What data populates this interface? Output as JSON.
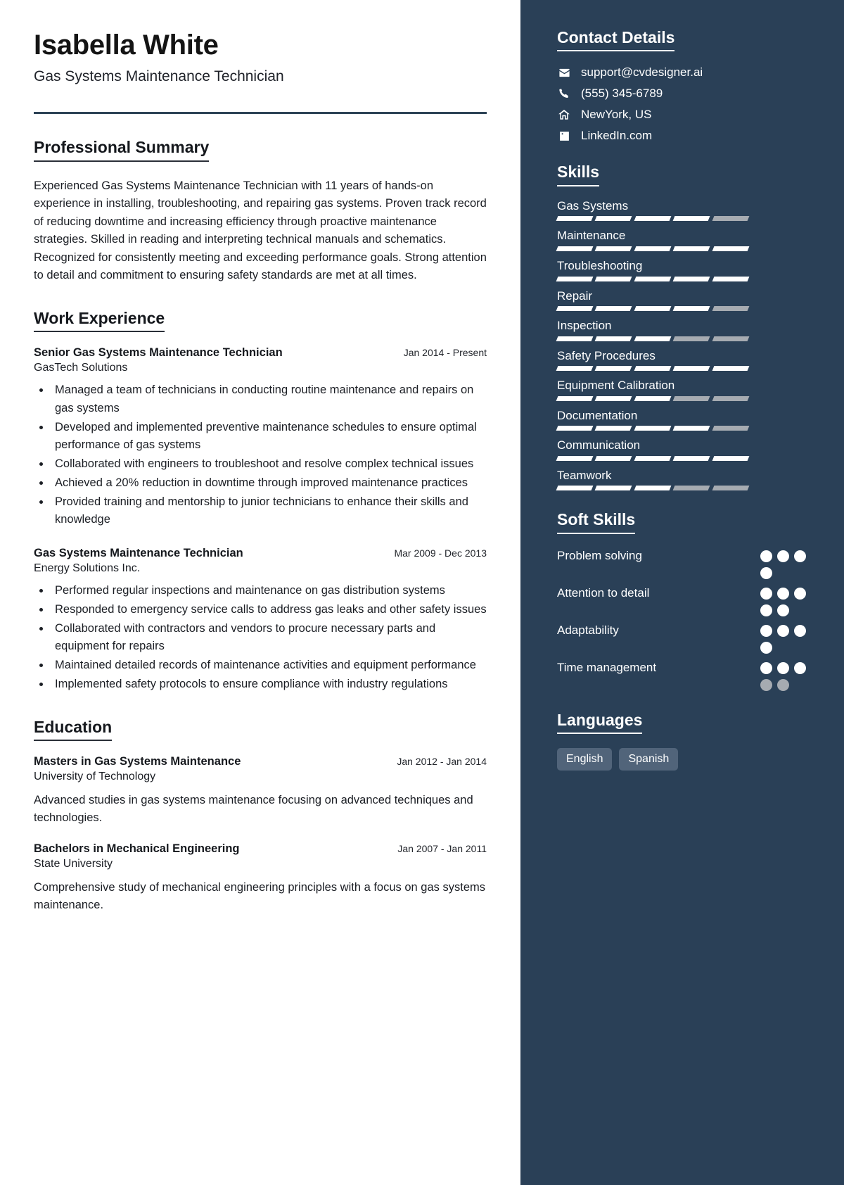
{
  "header": {
    "name": "Isabella White",
    "job_title": "Gas Systems Maintenance Technician"
  },
  "main": {
    "summary": {
      "heading": "Professional Summary",
      "text": "Experienced Gas Systems Maintenance Technician with 11 years of hands-on experience in installing, troubleshooting, and repairing gas systems. Proven track record of reducing downtime and increasing efficiency through proactive maintenance strategies. Skilled in reading and interpreting technical manuals and schematics. Recognized for consistently meeting and exceeding performance goals. Strong attention to detail and commitment to ensuring safety standards are met at all times."
    },
    "work": {
      "heading": "Work Experience",
      "entries": [
        {
          "title": "Senior Gas Systems Maintenance Technician",
          "date": "Jan 2014 - Present",
          "org": "GasTech Solutions",
          "bullets": [
            "Managed a team of technicians in conducting routine maintenance and repairs on gas systems",
            "Developed and implemented preventive maintenance schedules to ensure optimal performance of gas systems",
            "Collaborated with engineers to troubleshoot and resolve complex technical issues",
            "Achieved a 20% reduction in downtime through improved maintenance practices",
            "Provided training and mentorship to junior technicians to enhance their skills and knowledge"
          ]
        },
        {
          "title": "Gas Systems Maintenance Technician",
          "date": "Mar 2009 - Dec 2013",
          "org": "Energy Solutions Inc.",
          "bullets": [
            "Performed regular inspections and maintenance on gas distribution systems",
            "Responded to emergency service calls to address gas leaks and other safety issues",
            "Collaborated with contractors and vendors to procure necessary parts and equipment for repairs",
            "Maintained detailed records of maintenance activities and equipment performance",
            "Implemented safety protocols to ensure compliance with industry regulations"
          ]
        }
      ]
    },
    "education": {
      "heading": "Education",
      "entries": [
        {
          "title": "Masters in Gas Systems Maintenance",
          "date": "Jan 2012 - Jan 2014",
          "org": "University of Technology",
          "description": "Advanced studies in gas systems maintenance focusing on advanced techniques and technologies."
        },
        {
          "title": "Bachelors in Mechanical Engineering",
          "date": "Jan 2007 - Jan 2011",
          "org": "State University",
          "description": "Comprehensive study of mechanical engineering principles with a focus on gas systems maintenance."
        }
      ]
    }
  },
  "sidebar": {
    "contact": {
      "heading": "Contact Details",
      "items": [
        {
          "icon": "envelope-icon",
          "value": "support@cvdesigner.ai"
        },
        {
          "icon": "phone-icon",
          "value": "(555) 345-6789"
        },
        {
          "icon": "home-icon",
          "value": "NewYork, US"
        },
        {
          "icon": "linkedin-icon",
          "value": "LinkedIn.com"
        }
      ]
    },
    "skills": {
      "heading": "Skills",
      "max_level": 5,
      "items": [
        {
          "name": "Gas Systems",
          "level": 4
        },
        {
          "name": "Maintenance",
          "level": 5
        },
        {
          "name": "Troubleshooting",
          "level": 5
        },
        {
          "name": "Repair",
          "level": 4
        },
        {
          "name": "Inspection",
          "level": 3
        },
        {
          "name": "Safety Procedures",
          "level": 5
        },
        {
          "name": "Equipment Calibration",
          "level": 3
        },
        {
          "name": "Documentation",
          "level": 4
        },
        {
          "name": "Communication",
          "level": 5
        },
        {
          "name": "Teamwork",
          "level": 3
        }
      ]
    },
    "soft_skills": {
      "heading": "Soft Skills",
      "max_level": 5,
      "items": [
        {
          "name": "Problem solving",
          "level": 4,
          "shown": 4
        },
        {
          "name": "Attention to detail",
          "level": 5,
          "shown": 5
        },
        {
          "name": "Adaptability",
          "level": 4,
          "shown": 4
        },
        {
          "name": "Time management",
          "level": 3,
          "shown": 5
        }
      ]
    },
    "languages": {
      "heading": "Languages",
      "items": [
        "English",
        "Spanish"
      ]
    }
  },
  "colors": {
    "sidebar_bg": "#2a4057",
    "rule": "#2d4356",
    "bar_on": "#ffffff",
    "bar_off": "#a6abb1",
    "tag_bg": "#51647a"
  }
}
